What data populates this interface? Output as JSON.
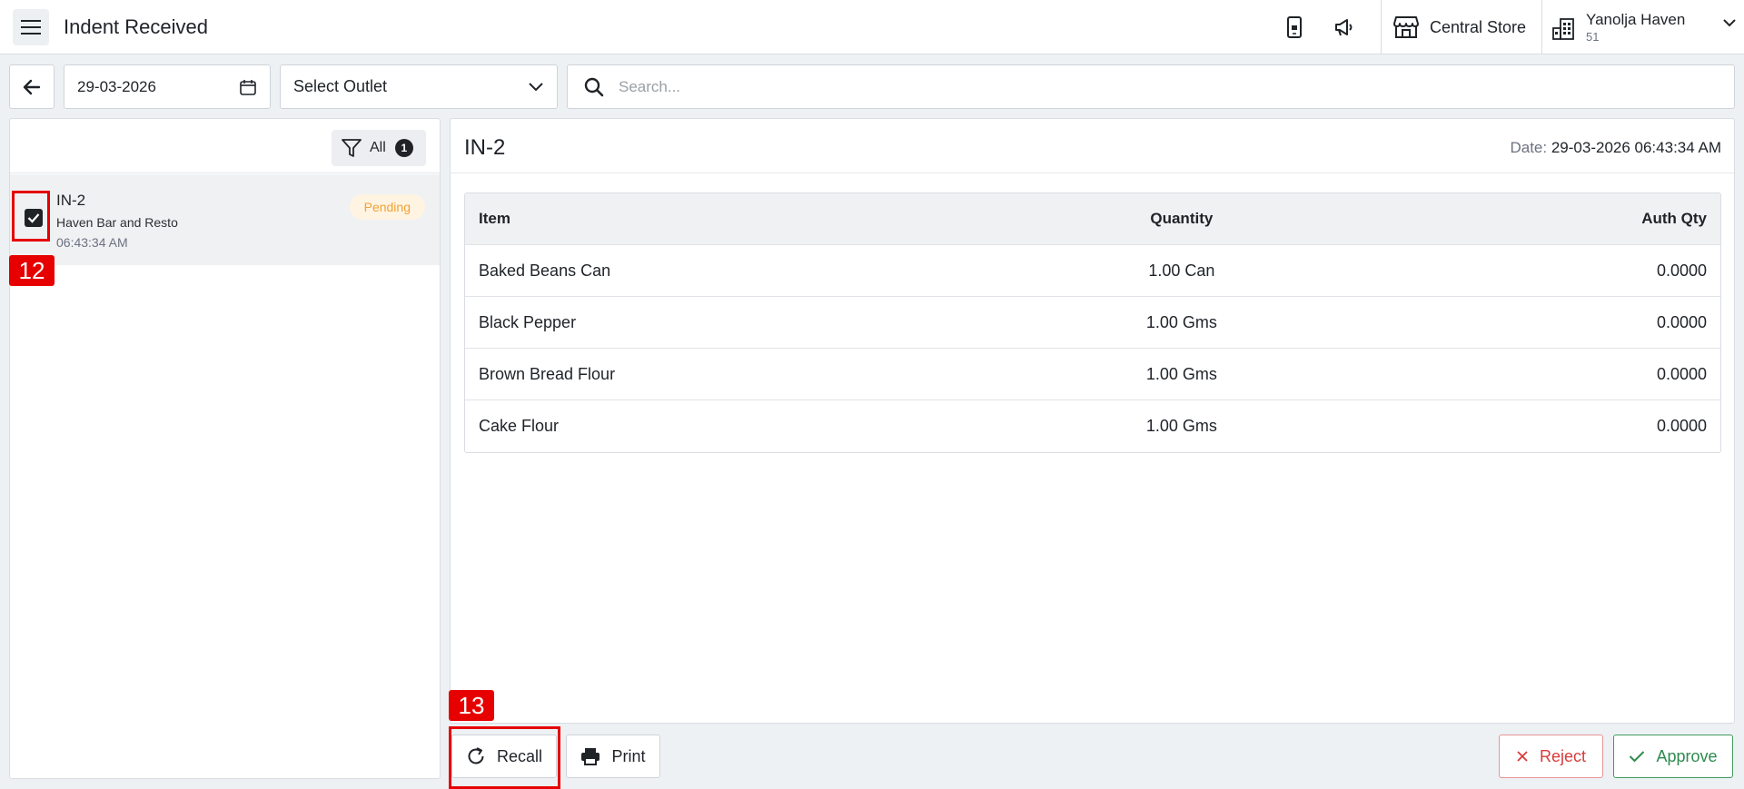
{
  "header": {
    "title": "Indent Received",
    "store_name": "Central Store",
    "property_name": "Yanolja Haven",
    "property_sub": "51"
  },
  "toolbar": {
    "date_value": "29-03-2026",
    "outlet_placeholder": "Select Outlet",
    "search_placeholder": "Search..."
  },
  "filter": {
    "label": "All",
    "count": "1"
  },
  "indents": [
    {
      "id": "IN-2",
      "outlet": "Haven Bar and Resto",
      "time": "06:43:34 AM",
      "status": "Pending",
      "checked": true
    }
  ],
  "detail": {
    "title": "IN-2",
    "date_label": "Date:",
    "date_value": "29-03-2026 06:43:34 AM",
    "columns": [
      "Item",
      "Quantity",
      "Auth Qty"
    ],
    "rows": [
      {
        "item": "Baked Beans Can",
        "quantity": "1.00 Can",
        "auth_qty": "0.0000"
      },
      {
        "item": "Black Pepper",
        "quantity": "1.00 Gms",
        "auth_qty": "0.0000"
      },
      {
        "item": "Brown Bread Flour",
        "quantity": "1.00 Gms",
        "auth_qty": "0.0000"
      },
      {
        "item": "Cake Flour",
        "quantity": "1.00 Gms",
        "auth_qty": "0.0000"
      }
    ]
  },
  "actions": {
    "recall_label": "Recall",
    "print_label": "Print",
    "reject_label": "Reject",
    "approve_label": "Approve"
  },
  "annotations": {
    "marker_checkbox": "12",
    "marker_recall": "13"
  },
  "colors": {
    "pending_text": "#f0a236",
    "pending_bg": "#fff4e2",
    "reject": "#d93b3b",
    "approve": "#2f8a4f",
    "annotation": "#e60000"
  }
}
